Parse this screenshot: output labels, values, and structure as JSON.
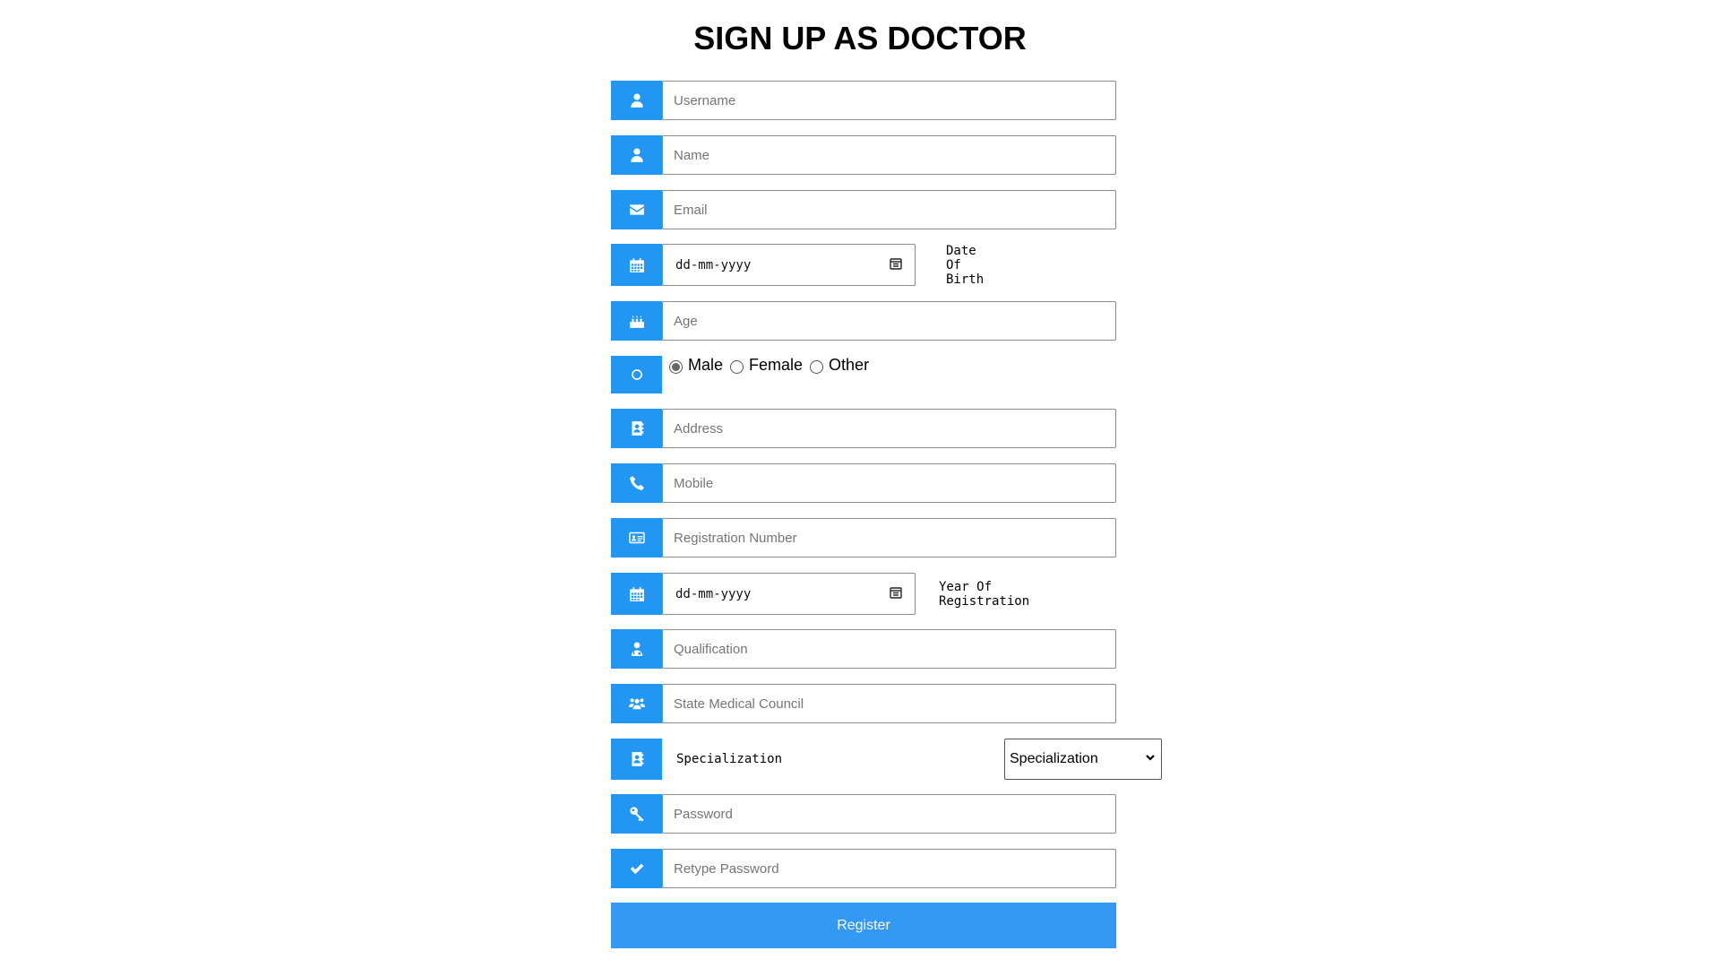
{
  "form": {
    "title": "SIGN UP AS DOCTOR",
    "accent_color": "#2196f3",
    "fields": {
      "username": {
        "placeholder": "Username",
        "icon": "user-icon"
      },
      "name": {
        "placeholder": "Name",
        "icon": "user-icon"
      },
      "email": {
        "placeholder": "Email",
        "icon": "envelope-icon"
      },
      "dob": {
        "value": "dd-mm-yyyy",
        "label": "Date Of Birth",
        "icon": "calendar-icon"
      },
      "age": {
        "placeholder": "Age",
        "icon": "birthday-cake-icon"
      },
      "gender": {
        "icon": "circle-icon",
        "options": [
          "Male",
          "Female",
          "Other"
        ],
        "selected": "Male"
      },
      "address": {
        "placeholder": "Address",
        "icon": "address-book-icon"
      },
      "mobile": {
        "placeholder": "Mobile",
        "icon": "phone-icon"
      },
      "registration_number": {
        "placeholder": "Registration Number",
        "icon": "id-card-icon"
      },
      "year_of_registration": {
        "value": "dd-mm-yyyy",
        "label": "Year Of Registration",
        "icon": "calendar-icon"
      },
      "qualification": {
        "placeholder": "Qualification",
        "icon": "user-md-icon"
      },
      "state_medical_council": {
        "placeholder": "State Medical Council",
        "icon": "users-icon"
      },
      "specialization": {
        "label": "Specialization",
        "selected": "Specialization",
        "icon": "address-book-icon"
      },
      "password": {
        "placeholder": "Password",
        "icon": "key-icon"
      },
      "retype_password": {
        "placeholder": "Retype Password",
        "icon": "check-icon"
      }
    },
    "register_label": "Register"
  }
}
